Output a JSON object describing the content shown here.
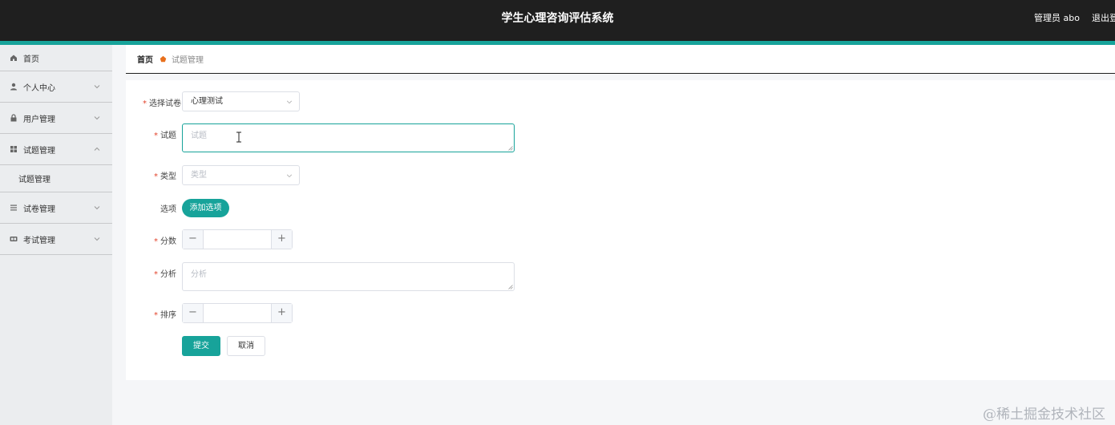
{
  "header": {
    "title": "学生心理咨询评估系统",
    "user": "管理员 abo",
    "logout": "退出登录",
    "accent_color": "#17a39a",
    "bg_color": "#1f1f1f"
  },
  "sidebar": {
    "items": [
      {
        "label": "首页",
        "icon": "home-icon"
      },
      {
        "label": "个人中心",
        "icon": "user-icon"
      },
      {
        "label": "用户管理",
        "icon": "lock-icon"
      },
      {
        "label": "试题管理",
        "icon": "grid-icon",
        "expanded": true,
        "children": [
          {
            "label": "试题管理"
          }
        ]
      },
      {
        "label": "试卷管理",
        "icon": "list-icon"
      },
      {
        "label": "考试管理",
        "icon": "exam-icon"
      }
    ]
  },
  "breadcrumb": {
    "home": "首页",
    "current": "试题管理"
  },
  "form": {
    "paper": {
      "label": "选择试卷",
      "value": "心理测试"
    },
    "question": {
      "label": "试题",
      "placeholder": "试题"
    },
    "type": {
      "label": "类型",
      "placeholder": "类型"
    },
    "options": {
      "label": "选项",
      "add_button": "添加选项"
    },
    "score": {
      "label": "分数",
      "value": ""
    },
    "analysis": {
      "label": "分析",
      "placeholder": "分析"
    },
    "order": {
      "label": "排序",
      "value": ""
    },
    "submit": "提交",
    "cancel": "取消",
    "required_mark": "*",
    "minus": "−",
    "plus": "+"
  },
  "watermark": "@稀土掘金技术社区"
}
